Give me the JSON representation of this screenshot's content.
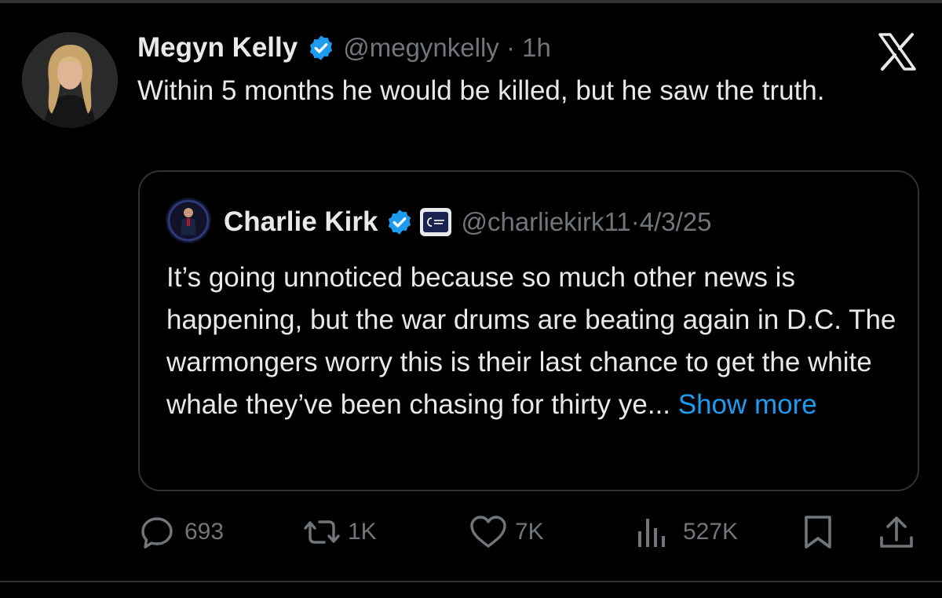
{
  "tweet": {
    "author_name": "Megyn Kelly",
    "handle": "@megynkelly",
    "separator": "·",
    "time": "1h",
    "text": "Within 5 months he would be killed, but he saw the truth."
  },
  "quote": {
    "author_name": "Charlie Kirk",
    "handle": "@charliekirk11",
    "separator": "·",
    "date": "4/3/25",
    "text": "It’s going unnoticed because so much other news is happening, but the war drums are beating again in D.C. The warmongers worry this is their last chance to get the white whale they’ve been chasing for thirty ye...",
    "show_more_label": "Show more"
  },
  "actions": {
    "replies": "693",
    "reposts": "1K",
    "likes": "7K",
    "views": "527K"
  },
  "icons": {
    "verified": "verified-badge-icon",
    "platform": "x-logo-icon",
    "reply": "reply-icon",
    "repost": "repost-icon",
    "like": "heart-icon",
    "views": "views-icon",
    "bookmark": "bookmark-icon",
    "share": "share-icon"
  },
  "colors": {
    "background": "#000000",
    "text": "#e7e9ea",
    "muted": "#71767b",
    "accent": "#1d9bf0",
    "border": "#2f3336"
  }
}
